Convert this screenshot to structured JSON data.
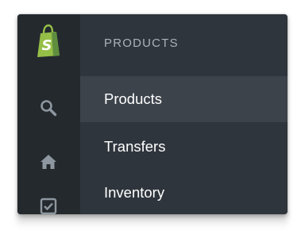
{
  "sidebar": {
    "section_title": "PRODUCTS",
    "items": [
      {
        "label": "Products",
        "active": true
      },
      {
        "label": "Transfers",
        "active": false
      },
      {
        "label": "Inventory",
        "active": false
      }
    ]
  },
  "rail": {
    "icons": [
      "shopify-logo",
      "search-icon",
      "home-icon",
      "orders-check-icon"
    ]
  },
  "colors": {
    "rail_bg": "#24292e",
    "panel_bg": "#2f353c",
    "active_bg": "#3c434b",
    "logo_green": "#95bf47"
  }
}
